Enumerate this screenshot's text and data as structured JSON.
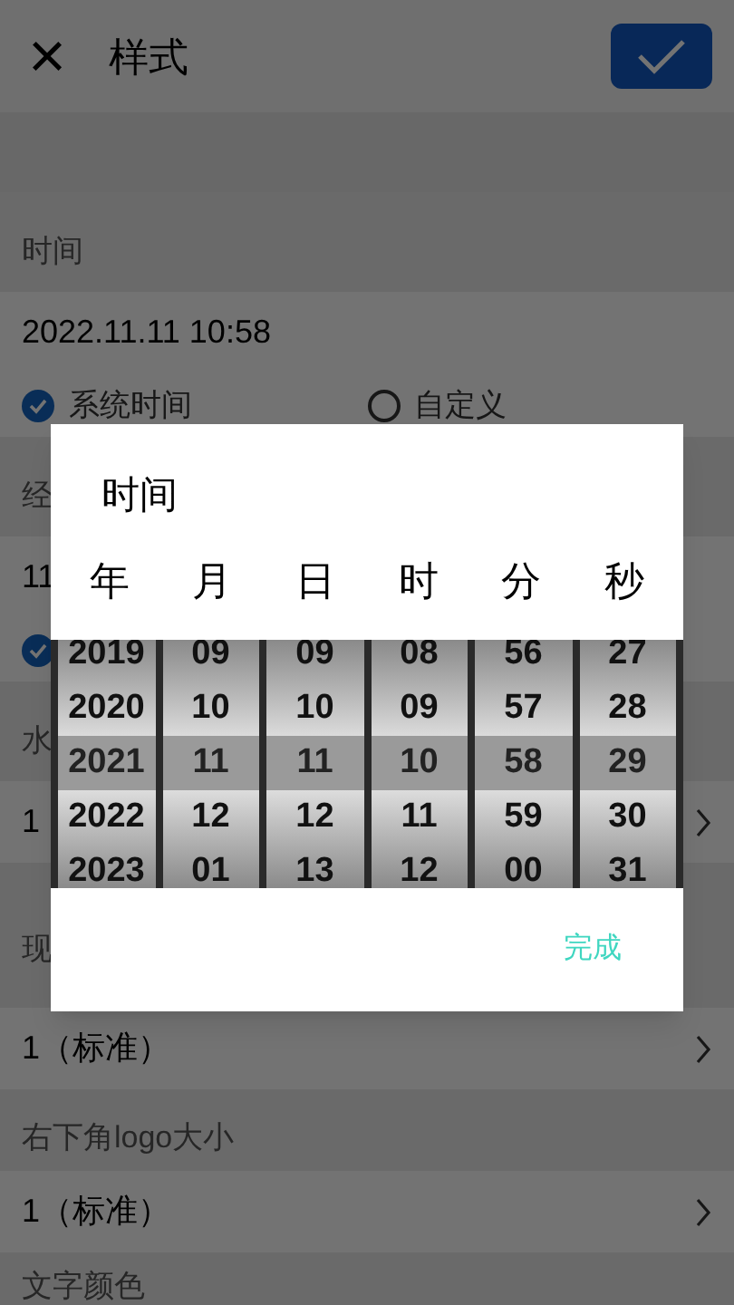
{
  "header": {
    "close": "×",
    "title": "样式"
  },
  "sections": [
    {
      "label": "时间",
      "value": "2022.11.11 10:58",
      "kind": "radio",
      "options": [
        {
          "label": "系统时间",
          "selected": true
        },
        {
          "label": "自定义",
          "selected": false
        }
      ]
    },
    {
      "label": "经",
      "value": "11",
      "kind": "check",
      "checked": true
    },
    {
      "label": "水",
      "value": "1",
      "kind": "chevron"
    },
    {
      "label": "现",
      "value": "1（标准）",
      "kind": "chevron"
    },
    {
      "label": "右下角logo大小",
      "value": "1（标准）",
      "kind": "chevron"
    },
    {
      "label": "文字颜色",
      "kind": "label"
    }
  ],
  "dialog": {
    "title": "时间",
    "columns": [
      {
        "label": "年",
        "items": [
          {
            "text": "2019",
            "selected": false
          },
          {
            "text": "2020",
            "selected": false
          },
          {
            "text": "2021",
            "selected": true
          },
          {
            "text": "2022",
            "selected": false
          },
          {
            "text": "2023",
            "selected": false
          }
        ]
      },
      {
        "label": "月",
        "items": [
          {
            "text": "09",
            "selected": false
          },
          {
            "text": "10",
            "selected": false
          },
          {
            "text": "11",
            "selected": true
          },
          {
            "text": "12",
            "selected": false
          },
          {
            "text": "01",
            "selected": false
          }
        ]
      },
      {
        "label": "日",
        "items": [
          {
            "text": "09",
            "selected": false
          },
          {
            "text": "10",
            "selected": false
          },
          {
            "text": "11",
            "selected": true
          },
          {
            "text": "12",
            "selected": false
          },
          {
            "text": "13",
            "selected": false
          }
        ]
      },
      {
        "label": "时",
        "items": [
          {
            "text": "08",
            "selected": false
          },
          {
            "text": "09",
            "selected": false
          },
          {
            "text": "10",
            "selected": true
          },
          {
            "text": "11",
            "selected": false
          },
          {
            "text": "12",
            "selected": false
          }
        ]
      },
      {
        "label": "分",
        "items": [
          {
            "text": "56",
            "selected": false
          },
          {
            "text": "57",
            "selected": false
          },
          {
            "text": "58",
            "selected": true
          },
          {
            "text": "59",
            "selected": false
          },
          {
            "text": "00",
            "selected": false
          }
        ]
      },
      {
        "label": "秒",
        "items": [
          {
            "text": "27",
            "selected": false
          },
          {
            "text": "28",
            "selected": false
          },
          {
            "text": "29",
            "selected": true
          },
          {
            "text": "30",
            "selected": false
          },
          {
            "text": "31",
            "selected": false
          }
        ]
      }
    ],
    "done": "完成"
  }
}
